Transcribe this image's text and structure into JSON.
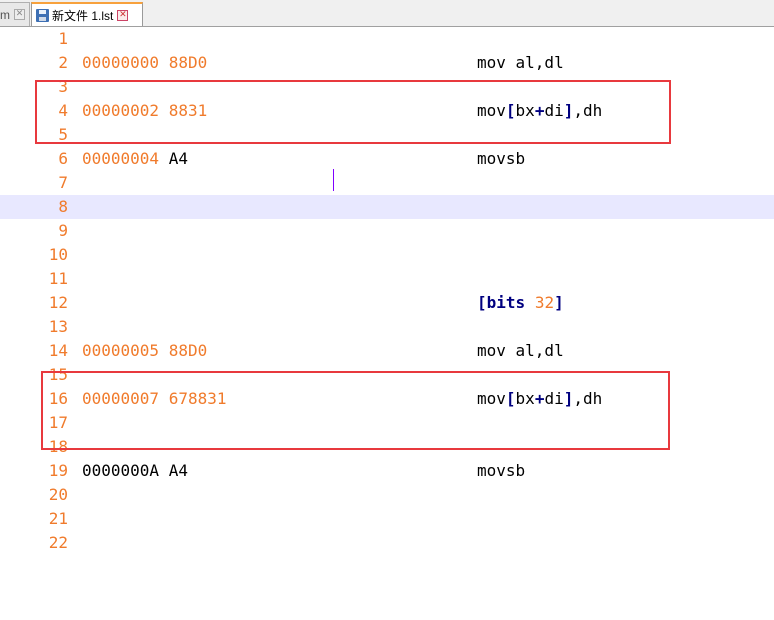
{
  "tabs": [
    {
      "label": "m",
      "active": false
    },
    {
      "label": "新文件 1.lst",
      "active": true
    }
  ],
  "lines": [
    {
      "n": "1",
      "addr": "",
      "bytes": "",
      "code": ""
    },
    {
      "n": "2",
      "addr": "00000000",
      "bytes": "88D0",
      "code": "mov al,dl"
    },
    {
      "n": "3",
      "addr": "",
      "bytes": "",
      "code": ""
    },
    {
      "n": "4",
      "addr": "00000002",
      "bytes": "8831",
      "code": "mov[bx+di],dh"
    },
    {
      "n": "5",
      "addr": "",
      "bytes": "",
      "code": ""
    },
    {
      "n": "6",
      "addr": "00000004",
      "bytes": "A4",
      "code": "movsb"
    },
    {
      "n": "7",
      "addr": "",
      "bytes": "",
      "code": ""
    },
    {
      "n": "8",
      "addr": "",
      "bytes": "",
      "code": ""
    },
    {
      "n": "9",
      "addr": "",
      "bytes": "",
      "code": ""
    },
    {
      "n": "10",
      "addr": "",
      "bytes": "",
      "code": ""
    },
    {
      "n": "11",
      "addr": "",
      "bytes": "",
      "code": ""
    },
    {
      "n": "12",
      "addr": "",
      "bytes": "",
      "code": "[bits 32]"
    },
    {
      "n": "13",
      "addr": "",
      "bytes": "",
      "code": ""
    },
    {
      "n": "14",
      "addr": "00000005",
      "bytes": "88D0",
      "code": "mov al,dl"
    },
    {
      "n": "15",
      "addr": "",
      "bytes": "",
      "code": ""
    },
    {
      "n": "16",
      "addr": "00000007",
      "bytes": "678831",
      "code": "mov[bx+di],dh"
    },
    {
      "n": "17",
      "addr": "",
      "bytes": "",
      "code": ""
    },
    {
      "n": "18",
      "addr": "",
      "bytes": "",
      "code": ""
    },
    {
      "n": "19",
      "addr": "0000000A",
      "bytes": "A4",
      "code": "movsb"
    },
    {
      "n": "20",
      "addr": "",
      "bytes": "",
      "code": ""
    },
    {
      "n": "21",
      "addr": "",
      "bytes": "",
      "code": ""
    },
    {
      "n": "22",
      "addr": "",
      "bytes": "",
      "code": ""
    }
  ],
  "current_line": "8",
  "colors": {
    "line_number": "#f07b2c",
    "current_line_bg": "#e8e8ff",
    "highlight_box": "#e8393e",
    "keyword": "#000080"
  }
}
